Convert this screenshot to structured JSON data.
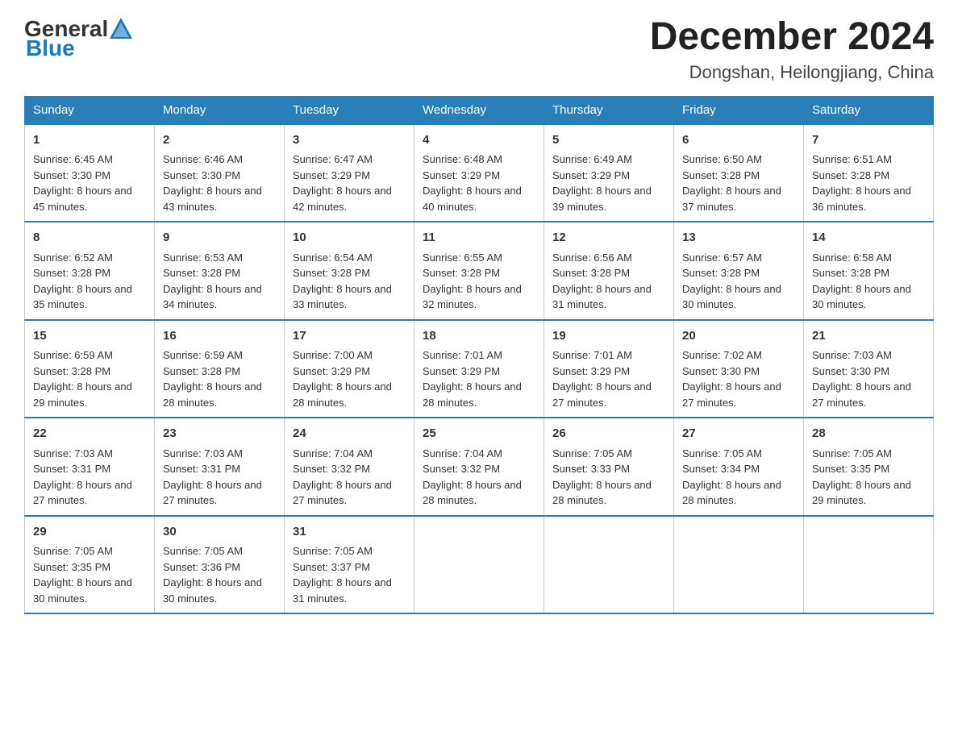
{
  "header": {
    "logo_general": "General",
    "logo_blue": "Blue",
    "month_title": "December 2024",
    "location": "Dongshan, Heilongjiang, China"
  },
  "weekdays": [
    "Sunday",
    "Monday",
    "Tuesday",
    "Wednesday",
    "Thursday",
    "Friday",
    "Saturday"
  ],
  "weeks": [
    [
      {
        "day": "1",
        "sunrise": "6:45 AM",
        "sunset": "3:30 PM",
        "daylight": "8 hours and 45 minutes."
      },
      {
        "day": "2",
        "sunrise": "6:46 AM",
        "sunset": "3:30 PM",
        "daylight": "8 hours and 43 minutes."
      },
      {
        "day": "3",
        "sunrise": "6:47 AM",
        "sunset": "3:29 PM",
        "daylight": "8 hours and 42 minutes."
      },
      {
        "day": "4",
        "sunrise": "6:48 AM",
        "sunset": "3:29 PM",
        "daylight": "8 hours and 40 minutes."
      },
      {
        "day": "5",
        "sunrise": "6:49 AM",
        "sunset": "3:29 PM",
        "daylight": "8 hours and 39 minutes."
      },
      {
        "day": "6",
        "sunrise": "6:50 AM",
        "sunset": "3:28 PM",
        "daylight": "8 hours and 37 minutes."
      },
      {
        "day": "7",
        "sunrise": "6:51 AM",
        "sunset": "3:28 PM",
        "daylight": "8 hours and 36 minutes."
      }
    ],
    [
      {
        "day": "8",
        "sunrise": "6:52 AM",
        "sunset": "3:28 PM",
        "daylight": "8 hours and 35 minutes."
      },
      {
        "day": "9",
        "sunrise": "6:53 AM",
        "sunset": "3:28 PM",
        "daylight": "8 hours and 34 minutes."
      },
      {
        "day": "10",
        "sunrise": "6:54 AM",
        "sunset": "3:28 PM",
        "daylight": "8 hours and 33 minutes."
      },
      {
        "day": "11",
        "sunrise": "6:55 AM",
        "sunset": "3:28 PM",
        "daylight": "8 hours and 32 minutes."
      },
      {
        "day": "12",
        "sunrise": "6:56 AM",
        "sunset": "3:28 PM",
        "daylight": "8 hours and 31 minutes."
      },
      {
        "day": "13",
        "sunrise": "6:57 AM",
        "sunset": "3:28 PM",
        "daylight": "8 hours and 30 minutes."
      },
      {
        "day": "14",
        "sunrise": "6:58 AM",
        "sunset": "3:28 PM",
        "daylight": "8 hours and 30 minutes."
      }
    ],
    [
      {
        "day": "15",
        "sunrise": "6:59 AM",
        "sunset": "3:28 PM",
        "daylight": "8 hours and 29 minutes."
      },
      {
        "day": "16",
        "sunrise": "6:59 AM",
        "sunset": "3:28 PM",
        "daylight": "8 hours and 28 minutes."
      },
      {
        "day": "17",
        "sunrise": "7:00 AM",
        "sunset": "3:29 PM",
        "daylight": "8 hours and 28 minutes."
      },
      {
        "day": "18",
        "sunrise": "7:01 AM",
        "sunset": "3:29 PM",
        "daylight": "8 hours and 28 minutes."
      },
      {
        "day": "19",
        "sunrise": "7:01 AM",
        "sunset": "3:29 PM",
        "daylight": "8 hours and 27 minutes."
      },
      {
        "day": "20",
        "sunrise": "7:02 AM",
        "sunset": "3:30 PM",
        "daylight": "8 hours and 27 minutes."
      },
      {
        "day": "21",
        "sunrise": "7:03 AM",
        "sunset": "3:30 PM",
        "daylight": "8 hours and 27 minutes."
      }
    ],
    [
      {
        "day": "22",
        "sunrise": "7:03 AM",
        "sunset": "3:31 PM",
        "daylight": "8 hours and 27 minutes."
      },
      {
        "day": "23",
        "sunrise": "7:03 AM",
        "sunset": "3:31 PM",
        "daylight": "8 hours and 27 minutes."
      },
      {
        "day": "24",
        "sunrise": "7:04 AM",
        "sunset": "3:32 PM",
        "daylight": "8 hours and 27 minutes."
      },
      {
        "day": "25",
        "sunrise": "7:04 AM",
        "sunset": "3:32 PM",
        "daylight": "8 hours and 28 minutes."
      },
      {
        "day": "26",
        "sunrise": "7:05 AM",
        "sunset": "3:33 PM",
        "daylight": "8 hours and 28 minutes."
      },
      {
        "day": "27",
        "sunrise": "7:05 AM",
        "sunset": "3:34 PM",
        "daylight": "8 hours and 28 minutes."
      },
      {
        "day": "28",
        "sunrise": "7:05 AM",
        "sunset": "3:35 PM",
        "daylight": "8 hours and 29 minutes."
      }
    ],
    [
      {
        "day": "29",
        "sunrise": "7:05 AM",
        "sunset": "3:35 PM",
        "daylight": "8 hours and 30 minutes."
      },
      {
        "day": "30",
        "sunrise": "7:05 AM",
        "sunset": "3:36 PM",
        "daylight": "8 hours and 30 minutes."
      },
      {
        "day": "31",
        "sunrise": "7:05 AM",
        "sunset": "3:37 PM",
        "daylight": "8 hours and 31 minutes."
      },
      null,
      null,
      null,
      null
    ]
  ],
  "labels": {
    "sunrise": "Sunrise:",
    "sunset": "Sunset:",
    "daylight": "Daylight:"
  }
}
